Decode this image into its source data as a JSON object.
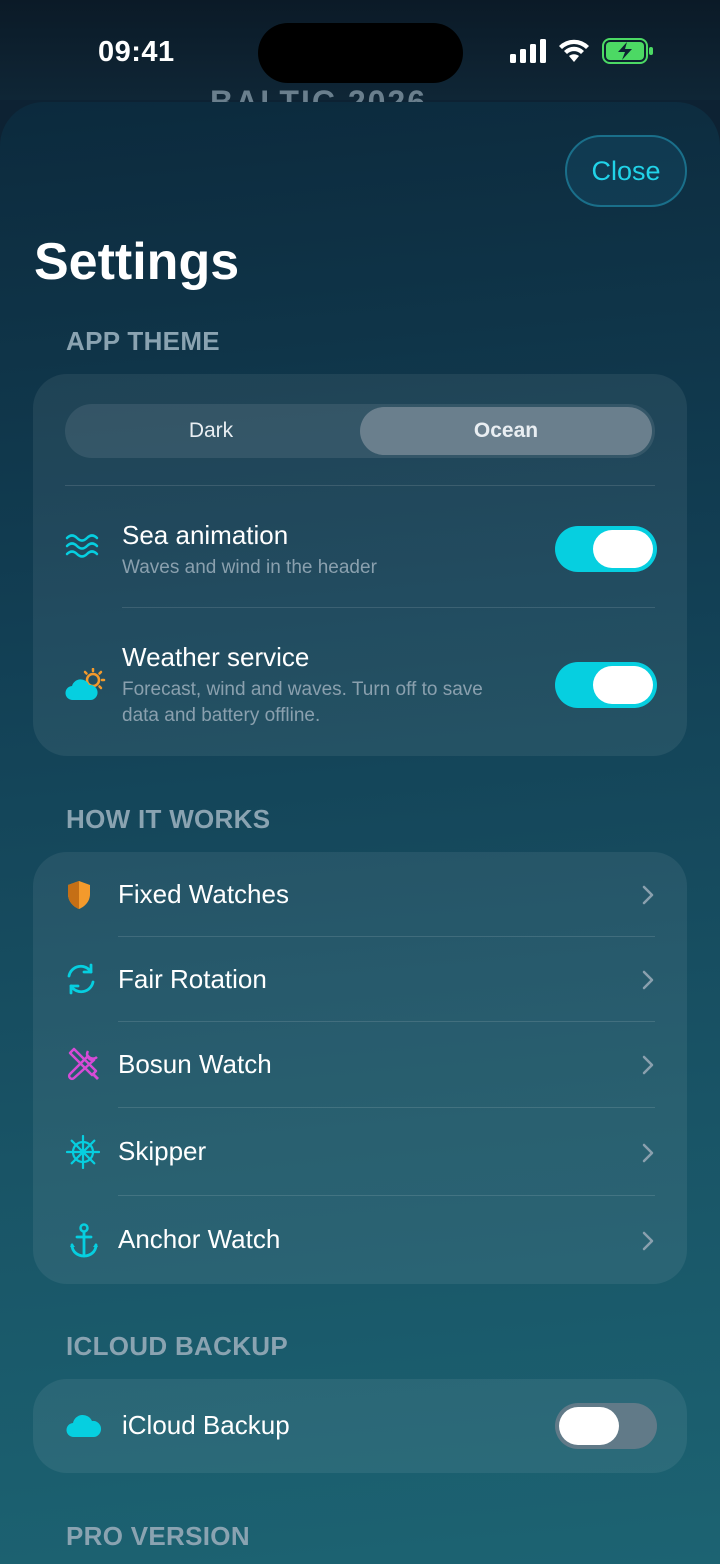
{
  "status": {
    "time": "09:41"
  },
  "background_title": "BALTIC 2026",
  "header": {
    "close_label": "Close",
    "title": "Settings"
  },
  "app_theme": {
    "header": "APP THEME",
    "segments": [
      "Dark",
      "Ocean"
    ],
    "selected": "Ocean",
    "sea_animation": {
      "title": "Sea animation",
      "subtitle": "Waves and wind in the header",
      "enabled": true
    },
    "weather_service": {
      "title": "Weather service",
      "subtitle_line1": "Forecast, wind and waves. Turn off to save",
      "subtitle_line2": "data and battery offline.",
      "enabled": true
    }
  },
  "how_it_works": {
    "header": "HOW IT WORKS",
    "items": [
      {
        "label": "Fixed Watches",
        "icon": "shield-icon"
      },
      {
        "label": "Fair Rotation",
        "icon": "rotation-arrows-icon"
      },
      {
        "label": "Bosun Watch",
        "icon": "tools-icon"
      },
      {
        "label": "Skipper",
        "icon": "helm-wheel-icon"
      },
      {
        "label": "Anchor Watch",
        "icon": "anchor-icon"
      }
    ]
  },
  "icloud": {
    "header": "ICLOUD BACKUP",
    "label": "iCloud Backup",
    "enabled": false
  },
  "pro": {
    "header": "PRO VERSION"
  },
  "colors": {
    "accent": "#06cfe0",
    "orange": "#f39a2c",
    "magenta": "#d64bd6"
  }
}
